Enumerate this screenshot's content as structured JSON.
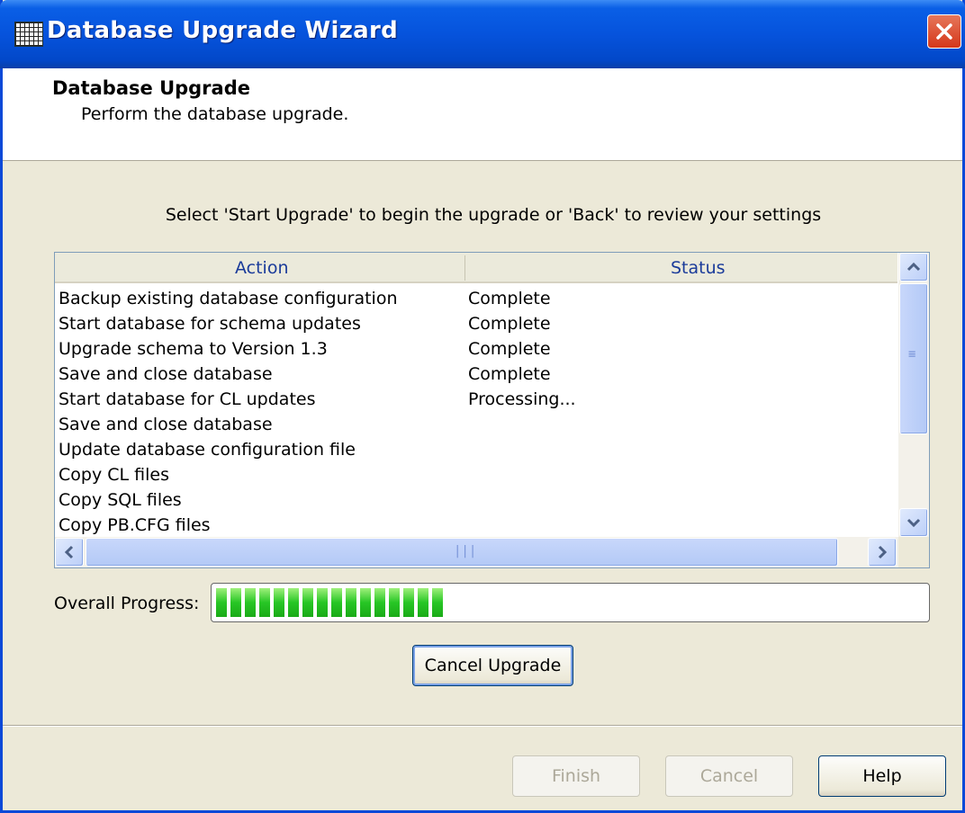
{
  "window": {
    "title": "Database Upgrade Wizard"
  },
  "header": {
    "title": "Database Upgrade",
    "subtitle": "Perform the database upgrade."
  },
  "instruction": "Select 'Start Upgrade' to begin the upgrade or 'Back' to review your settings",
  "list": {
    "columns": [
      "Action",
      "Status"
    ],
    "rows": [
      {
        "action": "Backup existing database configuration",
        "status": "Complete"
      },
      {
        "action": "Start database for schema updates",
        "status": "Complete"
      },
      {
        "action": "Upgrade schema to Version 1.3",
        "status": "Complete"
      },
      {
        "action": "Save and close database",
        "status": "Complete"
      },
      {
        "action": "Start database for CL updates",
        "status": "Processing..."
      },
      {
        "action": "Save and close database",
        "status": ""
      },
      {
        "action": "Update database configuration file",
        "status": ""
      },
      {
        "action": "Copy CL files",
        "status": ""
      },
      {
        "action": "Copy SQL files",
        "status": ""
      },
      {
        "action": "Copy PB.CFG files",
        "status": ""
      }
    ]
  },
  "progress": {
    "label": "Overall Progress:",
    "fraction": 0.33
  },
  "buttons": {
    "cancel_upgrade": "Cancel Upgrade",
    "finish": "Finish",
    "cancel": "Cancel",
    "help": "Help"
  },
  "colors": {
    "titlebar": "#0653dc",
    "progress_fill": "#27c625",
    "close_button": "#d5371a"
  }
}
